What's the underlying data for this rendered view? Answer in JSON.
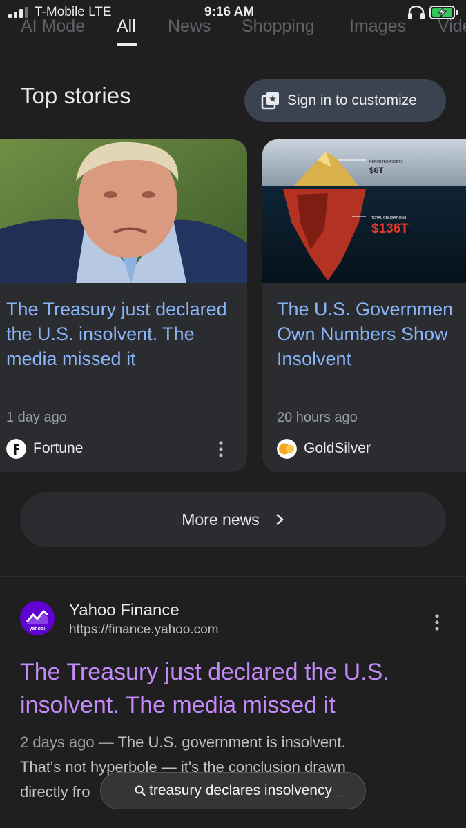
{
  "status_bar": {
    "carrier": "T-Mobile  LTE",
    "time": "9:16 AM"
  },
  "tabs": [
    {
      "label": "AI Mode"
    },
    {
      "label": "All"
    },
    {
      "label": "News"
    },
    {
      "label": "Shopping"
    },
    {
      "label": "Images"
    },
    {
      "label": "Vide"
    }
  ],
  "top_stories": {
    "title": "Top stories",
    "sign_in_label": "Sign in to customize",
    "cards": [
      {
        "headline": "The Treasury just declared the U.S. insolvent. The media missed it",
        "age": "1 day ago",
        "source": "Fortune",
        "logo_letter": "F",
        "headline_color": "#8ab4f8"
      },
      {
        "headline_lines": [
          "The U.S. Governmen",
          "Own Numbers Show",
          "Insolvent"
        ],
        "age": "20 hours ago",
        "source": "GoldSilver",
        "image_labels": {
          "top_small": "REPORTED ASSETS",
          "top_value": "$6T",
          "bottom_small": "TOTAL OBLIGATIONS",
          "bottom_value": "$136T"
        }
      }
    ],
    "more_news_label": "More news"
  },
  "result": {
    "site_name": "Yahoo Finance",
    "url": "https://finance.yahoo.com",
    "logo_text": "yahoo!",
    "title": "The Treasury just declared the U.S. insolvent. The media missed it",
    "snippet_date": "2 days ago",
    "snippet_dash": " — ",
    "snippet_line1": "The U.S. government is insolvent.",
    "snippet_line2": "That's not hyperbole — it's the conclusion drawn",
    "snippet_line3": "directly fro",
    "snippet_line3_end": "...",
    "title_color": "#c58af9"
  },
  "query_pill": {
    "label": "treasury declares insolvency"
  },
  "colors": {
    "background": "#1f1f1f",
    "card": "#2b2c2f",
    "link_blue": "#8ab4f8",
    "visited_purple": "#c58af9",
    "yahoo_purple": "#5f01d1"
  }
}
